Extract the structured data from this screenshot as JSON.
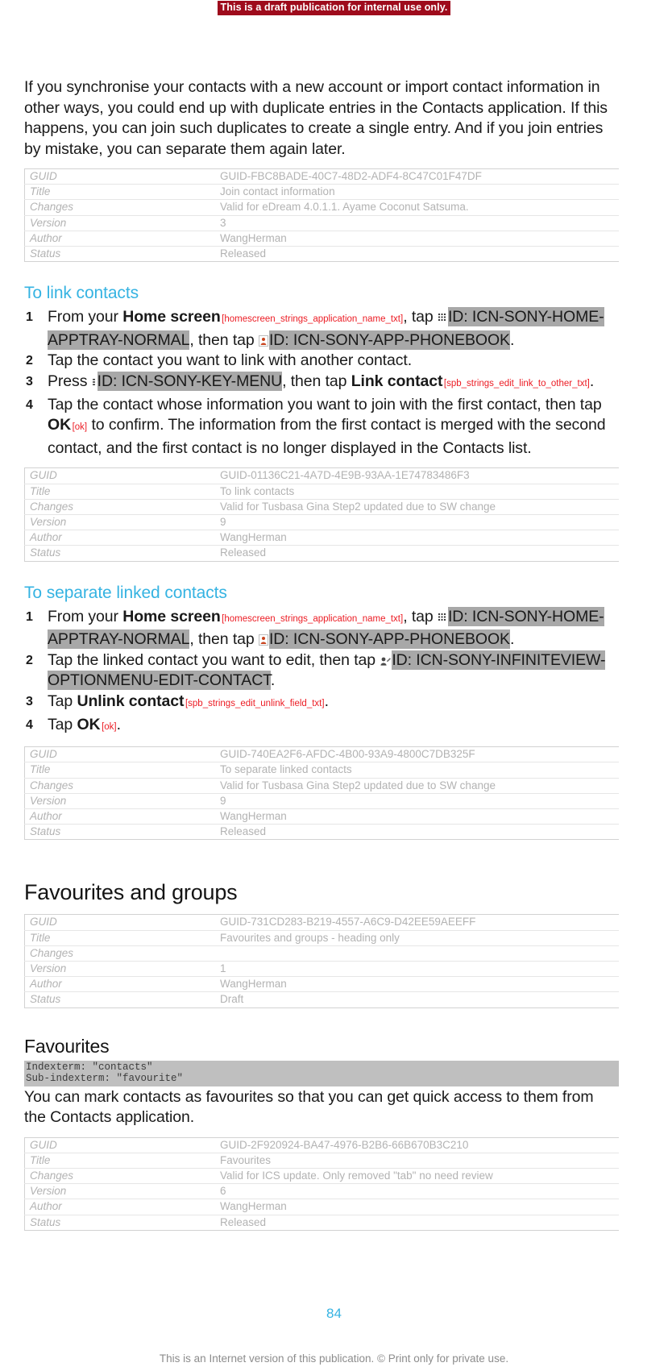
{
  "banner": {
    "text": "This is a draft publication for internal use only.",
    "bg_color": "#9e0b1c",
    "text_color": "#ffffff"
  },
  "colors": {
    "task_heading": "#35b3e2",
    "string_id": "#ec1c24",
    "icon_id_highlight": "#a8a8a8",
    "meta_text": "#b3b3b3",
    "page_number": "#35b3e2"
  },
  "intro": {
    "paragraph": "If you synchronise your contacts with a new account or import contact information in other ways, you could end up with duplicate entries in the Contacts application. If this happens, you can join such duplicates to create a single entry. And if you join entries by mistake, you can separate them again later."
  },
  "meta_labels": {
    "guid": "GUID",
    "title": "Title",
    "changes": "Changes",
    "version": "Version",
    "author": "Author",
    "status": "Status"
  },
  "tables": [
    {
      "guid": "GUID-FBC8BADE-40C7-48D2-ADF4-8C47C01F47DF",
      "title": "Join contact information",
      "changes": "Valid for eDream 4.0.1.1. Ayame Coconut Satsuma.",
      "version": "3",
      "author": "WangHerman",
      "status": "Released"
    },
    {
      "guid": "GUID-01136C21-4A7D-4E9B-93AA-1E74783486F3",
      "title": "To link contacts",
      "changes": "Valid for Tusbasa Gina Step2 updated due to SW change",
      "version": "9",
      "author": "WangHerman",
      "status": "Released"
    },
    {
      "guid": "GUID-740EA2F6-AFDC-4B00-93A9-4800C7DB325F",
      "title": "To separate linked contacts",
      "changes": "Valid for Tusbasa Gina Step2 updated due to SW change",
      "version": "9",
      "author": "WangHerman",
      "status": "Released"
    },
    {
      "guid": "GUID-731CD283-B219-4557-A6C9-D42EE59AEEFF",
      "title": "Favourites and groups - heading only",
      "changes": "",
      "version": "1",
      "author": "WangHerman",
      "status": "Draft"
    },
    {
      "guid": "GUID-2F920924-BA47-4976-B2B6-66B670B3C210",
      "title": "Favourites",
      "changes": "Valid for ICS update. Only removed \"tab\" no need review",
      "version": "6",
      "author": "WangHerman",
      "status": "Released"
    }
  ],
  "task_link": {
    "heading": "To link contacts",
    "step1": {
      "a": "From your ",
      "home_screen": "Home screen",
      "strid_home": "[homescreen_strings_application_name_txt]",
      "b": ", tap ",
      "icon1_id": "ID: ICN-SONY-HOME-APPTRAY-NORMAL",
      "c": ", then tap ",
      "icon2_id": "ID: ICN-SONY-APP-PHONEBOOK",
      "d": "."
    },
    "step2": "Tap the contact you want to link with another contact.",
    "step3": {
      "a": "Press ",
      "icon_id": "ID: ICN-SONY-KEY-MENU",
      "b": ", then tap ",
      "ui": "Link contact",
      "strid": "[spb_strings_edit_link_to_other_txt]",
      "c": "."
    },
    "step4": {
      "a": "Tap the contact whose information you want to join with the first contact, then tap ",
      "ui": "OK",
      "strid": "[ok]",
      "b": " to confirm. The information from the first contact is merged with the second contact, and the first contact is no longer displayed in the Contacts list."
    }
  },
  "task_separate": {
    "heading": "To separate linked contacts",
    "step1": {
      "a": "From your ",
      "home_screen": "Home screen",
      "strid_home": "[homescreen_strings_application_name_txt]",
      "b": ", tap ",
      "icon1_id": "ID: ICN-SONY-HOME-APPTRAY-NORMAL",
      "c": ", then tap ",
      "icon2_id": "ID: ICN-SONY-APP-PHONEBOOK",
      "d": "."
    },
    "step2": {
      "a": "Tap the linked contact you want to edit, then tap ",
      "icon_id": "ID: ICN-SONY-INFINITEVIEW-OPTIONMENU-EDIT-CONTACT",
      "b": "."
    },
    "step3": {
      "a": "Tap ",
      "ui": "Unlink contact",
      "strid": "[spb_strings_edit_unlink_field_txt]",
      "b": "."
    },
    "step4": {
      "a": "Tap ",
      "ui": "OK",
      "strid": "[ok]",
      "b": "."
    }
  },
  "favourites_and_groups": {
    "heading": "Favourites and groups"
  },
  "favourites": {
    "heading": "Favourites",
    "indexterm": "Indexterm: \"contacts\"",
    "sub_indexterm": "Sub-indexterm: \"favourite\"",
    "paragraph": "You can mark contacts as favourites so that you can get quick access to them from the Contacts application."
  },
  "footer": {
    "page_number": "84",
    "note": "This is an Internet version of this publication. © Print only for private use."
  }
}
